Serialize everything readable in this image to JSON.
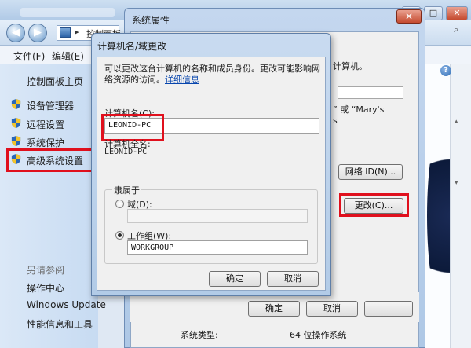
{
  "control_panel": {
    "nav_back": "◀",
    "nav_forward": "▶",
    "address": "控制面板",
    "menu": [
      "文件(F)",
      "编辑(E)"
    ],
    "sidebar_main": "控制面板主页",
    "sidebar_items": [
      "设备管理器",
      "远程设置",
      "系统保护",
      "高级系统设置"
    ],
    "see_also_title": "另请参阅",
    "see_also_items": [
      "操作中心",
      "Windows Update",
      "性能信息和工具"
    ],
    "help_icon": "?",
    "bottom_label": "系统类型:",
    "bottom_value": "64 位操作系统"
  },
  "system_properties": {
    "title": "系统属性",
    "close": "✕",
    "text_line1": "计算机。",
    "text_line2": "” 或 “Mary's",
    "text_line3": "s",
    "network_id_button": "网络 ID(N)...",
    "change_button": "更改(C)...",
    "ok_button": "确定",
    "cancel_button": "取消"
  },
  "computer_name_dialog": {
    "title": "计算机名/域更改",
    "description_line1": "可以更改这台计算机的名称和成员身份。更改可能影响网",
    "description_line2_prefix": "络资源的访问。",
    "details_link": "详细信息",
    "computer_name_label": "计算机名(C):",
    "computer_name_value": "LEONID-PC",
    "full_name_label": "计算机全名:",
    "full_name_value": "LEONID-PC",
    "member_of_label": "隶属于",
    "domain_label": "域(D):",
    "domain_value": "",
    "workgroup_label": "工作组(W):",
    "workgroup_value": "WORKGROUP",
    "ok_button": "确定",
    "cancel_button": "取消"
  },
  "colors": {
    "highlight_red": "#e0101d",
    "link_blue": "#0645ad"
  }
}
